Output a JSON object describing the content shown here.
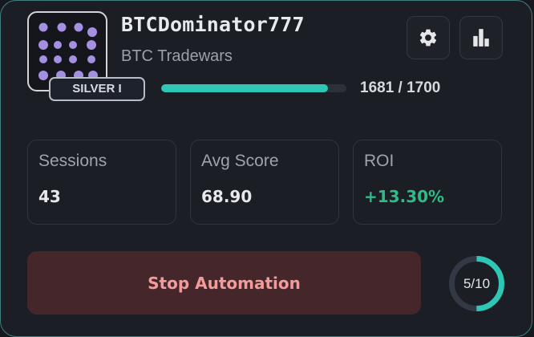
{
  "profile": {
    "username": "BTCDominator777",
    "game": "BTC Tradewars",
    "rank": "SILVER I",
    "avatar_icon": "dot-pattern-avatar-icon",
    "avatar_color": "#a48fe0"
  },
  "xp": {
    "current": 1681,
    "max": 1700,
    "label": "1681 / 1700",
    "fill_fraction": 0.9,
    "fill_color": "#2ec7b6"
  },
  "actions": {
    "settings_icon": "gear-icon",
    "stats_icon": "bar-chart-icon"
  },
  "stats": [
    {
      "label": "Sessions",
      "value": "43"
    },
    {
      "label": "Avg Score",
      "value": "68.90"
    },
    {
      "label": "ROI",
      "value": "+13.30%",
      "color": "#2fba86"
    }
  ],
  "automation": {
    "button_label": "Stop Automation",
    "progress_label": "5/10",
    "progress_done": 5,
    "progress_total": 10,
    "ring_color": "#2ec7b6"
  }
}
